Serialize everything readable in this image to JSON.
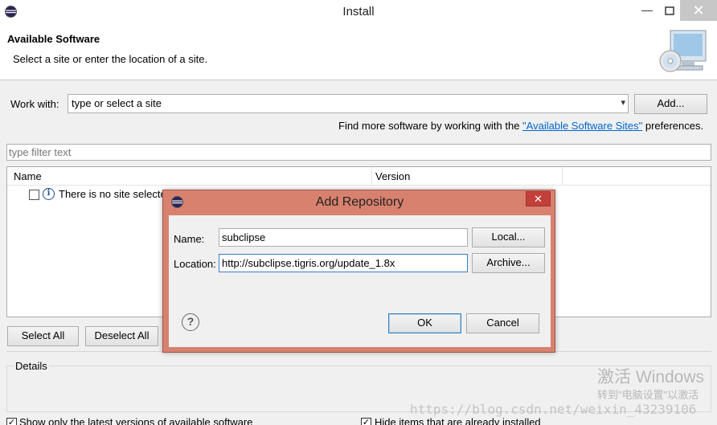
{
  "window": {
    "title": "Install",
    "app_icon": "eclipse-icon",
    "minimize": "—",
    "close": "✕"
  },
  "header": {
    "title": "Available Software",
    "description": "Select a site or enter the location of a site.",
    "banner_icon": "cd-monitor-icon"
  },
  "work_with": {
    "label": "Work with:",
    "value": "type or select a site",
    "add_button": "Add...",
    "find_more_prefix": "Find more software by working with the ",
    "find_more_link": "\"Available Software Sites\"",
    "find_more_suffix": " preferences."
  },
  "filter": {
    "placeholder": "type filter text"
  },
  "tree": {
    "columns": [
      "Name",
      "Version"
    ],
    "rows": [
      {
        "name": "There is no site selected.",
        "icon": "info-icon",
        "checked": false
      }
    ]
  },
  "buttons": {
    "select_all": "Select All",
    "deselect_all": "Deselect All"
  },
  "details": {
    "label": "Details"
  },
  "options": {
    "show_latest": {
      "label": "Show only the latest versions of available software",
      "checked": true
    },
    "hide_installed": {
      "label": "Hide items that are already installed",
      "checked": true
    }
  },
  "watermark": {
    "activate": "激活 Windows",
    "activate_sub": "转到\"电脑设置\"以激活",
    "blog": "https://blog.csdn.net/weixin_43239106"
  },
  "dialog": {
    "title": "Add Repository",
    "close": "✕",
    "name_label": "Name:",
    "name_value": "subclipse",
    "local_button": "Local...",
    "location_label": "Location:",
    "location_value": "http://subclipse.tigris.org/update_1.8x",
    "archive_button": "Archive...",
    "help_icon": "?",
    "ok_button": "OK",
    "cancel_button": "Cancel"
  },
  "colors": {
    "dialog_frame": "#d8816f",
    "close_red": "#c3403a",
    "link": "#0066cc"
  }
}
